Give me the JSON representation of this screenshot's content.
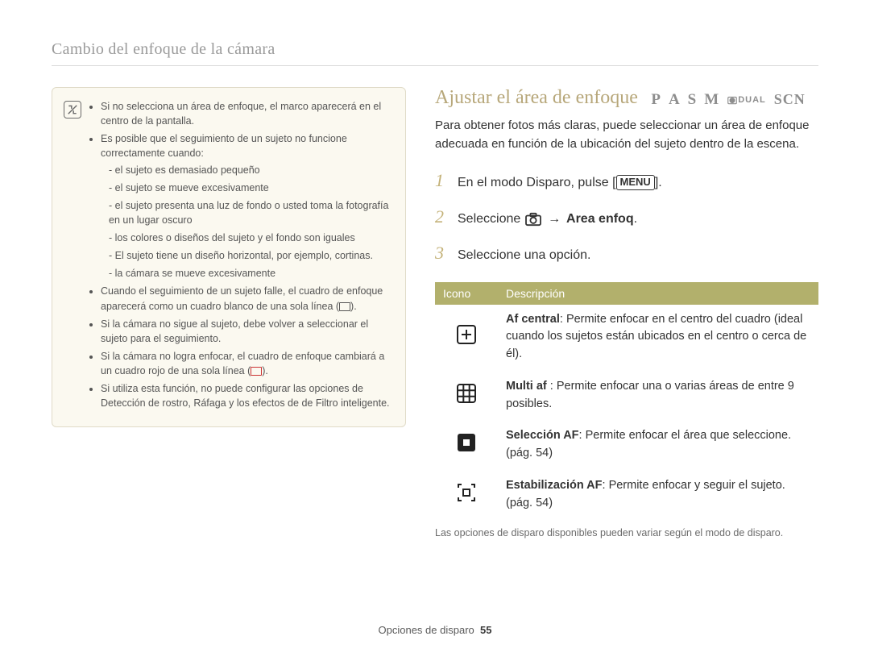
{
  "breadcrumb": "Cambio del enfoque de la cámara",
  "infobox": {
    "b1": "Si no selecciona un área de enfoque, el marco aparecerá en el centro de la pantalla.",
    "b2": "Es posible que el seguimiento de un sujeto no funcione correctamente cuando:",
    "b2_1": "el sujeto es demasiado pequeño",
    "b2_2": "el sujeto se mueve excesivamente",
    "b2_3": "el sujeto presenta una luz de fondo o usted toma la fotografía en un lugar oscuro",
    "b2_4": "los colores o diseños del sujeto y el fondo son iguales",
    "b2_5": "El sujeto tiene un diseño horizontal, por ejemplo, cortinas.",
    "b2_6": "la cámara se mueve excesivamente",
    "b3_a": "Cuando el seguimiento de un sujeto falle, el cuadro de enfoque aparecerá como un cuadro blanco de una sola línea (",
    "b3_b": ").",
    "b4": "Si la cámara no sigue al sujeto, debe volver a seleccionar el sujeto para el seguimiento.",
    "b5_a": "Si la cámara no logra enfocar, el cuadro de enfoque cambiará a un cuadro rojo de una sola línea (",
    "b5_b": ").",
    "b6": "Si utiliza esta función, no puede configurar las opciones de Detección de rostro, Ráfaga y los efectos de de Filtro inteligente."
  },
  "section_title": "Ajustar el área de enfoque",
  "modes": {
    "P": "P",
    "A": "A",
    "S": "S",
    "M": "M",
    "DUAL": "DUAL",
    "SCN": "SCN"
  },
  "lead": "Para obtener fotos más claras, puede seleccionar un área de enfoque adecuada en función de la ubicación del sujeto dentro de la escena.",
  "steps": {
    "s1_a": "En el modo Disparo, pulse [",
    "s1_menu": "MENU",
    "s1_b": "].",
    "s2_a": "Seleccione ",
    "s2_arrow": "→",
    "s2_b": " Area enfoq",
    "s2_c": ".",
    "s3": "Seleccione una opción."
  },
  "table": {
    "h_icon": "Icono",
    "h_desc": "Descripción",
    "r1_t": "Af central",
    "r1_d": ": Permite enfocar en el centro del cuadro (ideal cuando los sujetos están ubicados en el centro o cerca de él).",
    "r2_t": "Multi af ",
    "r2_d": ": Permite enfocar una o varias áreas de entre 9 posibles.",
    "r3_t": "Selección AF",
    "r3_d": ": Permite enfocar el área que seleccione. (pág. 54)",
    "r4_t": "Estabilización AF",
    "r4_d": ": Permite enfocar y seguir el sujeto. (pág. 54)"
  },
  "footnote": "Las opciones de disparo disponibles pueden variar según el modo de disparo.",
  "footer": {
    "section": "Opciones de disparo",
    "page": "55"
  }
}
